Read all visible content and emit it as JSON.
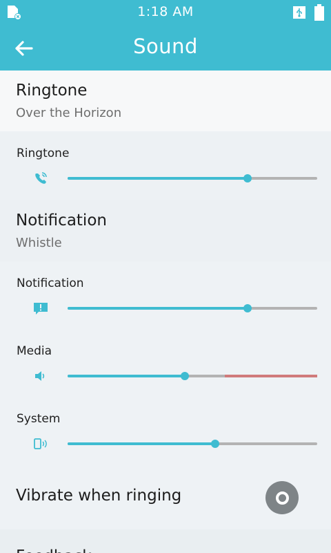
{
  "status_bar": {
    "time": "1:18 AM",
    "left_icon": "notification-x-icon",
    "usb_icon": "usb-icon",
    "battery_icon": "battery-icon",
    "color": "#3fbcd1"
  },
  "app_bar": {
    "title": "Sound",
    "back_icon": "arrow-left-icon"
  },
  "ringtone_pref": {
    "title": "Ringtone",
    "summary": "Over the Horizon"
  },
  "volumes": {
    "ringtone": {
      "label": "Ringtone",
      "icon": "phone-ring-icon",
      "level": 0.72
    },
    "notification": {
      "label": "Notification",
      "icon": "message-alert-icon",
      "level": 0.72
    },
    "media": {
      "label": "Media",
      "icon": "speaker-icon",
      "level": 0.47,
      "safe_limit": 0.63
    },
    "system": {
      "label": "System",
      "icon": "device-sound-icon",
      "level": 0.59
    }
  },
  "notification_pref": {
    "title": "Notification",
    "summary": "Whistle"
  },
  "vibrate": {
    "title": "Vibrate when ringing",
    "enabled": false
  },
  "feedback": {
    "title": "Feedback"
  },
  "colors": {
    "accent": "#3fbcd1",
    "track": "#b3b3b3",
    "warning": "#d07b7b"
  }
}
